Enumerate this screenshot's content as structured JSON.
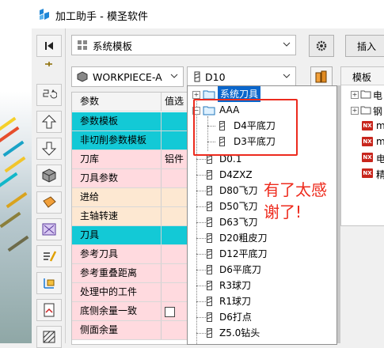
{
  "window": {
    "title": "加工助手 - 模圣软件"
  },
  "toolbar": {
    "template_combo": "系统模板",
    "workpiece_combo": "WORKPIECE-A",
    "tool_combo": "D10",
    "insert_button": "插入"
  },
  "param_table": {
    "headers": [
      "参数",
      "值选"
    ],
    "rows": [
      {
        "label": "参数模板",
        "value": "",
        "color": "cyan"
      },
      {
        "label": "非切削参数模板",
        "value": "",
        "color": "cyan"
      },
      {
        "label": "刀库",
        "value": "铝件",
        "color": "pink"
      },
      {
        "label": "刀具参数",
        "value": "",
        "color": "pink"
      },
      {
        "label": "进给",
        "value": "",
        "color": "peach"
      },
      {
        "label": "主轴转速",
        "value": "",
        "color": "peach"
      },
      {
        "label": "刀具",
        "value": "",
        "color": "cyan"
      },
      {
        "label": "参考刀具",
        "value": "",
        "color": "pink"
      },
      {
        "label": "参考重叠距离",
        "value": "",
        "color": "pink"
      },
      {
        "label": "处理中的工件",
        "value": "",
        "color": "pink"
      },
      {
        "label": "底侧余量一致",
        "value": "",
        "color": "pink",
        "checkbox": true
      },
      {
        "label": "侧面余量",
        "value": "",
        "color": "pink"
      }
    ]
  },
  "tool_dropdown": {
    "root_label": "系统刀具",
    "group_label": "AAA",
    "group_children": [
      "D4平底刀",
      "D3平底刀"
    ],
    "items": [
      "D0.1",
      "D4ZXZ",
      "D80飞刀",
      "D50飞刀",
      "D63飞刀",
      "D20粗皮刀",
      "D12平底刀",
      "D6平底刀",
      "R3球刀",
      "R1球刀",
      "D6打点",
      "Z5.0钻头"
    ]
  },
  "template_panel": {
    "header": "模板",
    "folders": [
      "电",
      "钢"
    ],
    "items": [
      "m",
      "m",
      "电",
      "精"
    ]
  },
  "annotation": {
    "text": "有了太感谢了!",
    "color": "#ee2a1c"
  },
  "colors": {
    "cyan": "#13c9d6",
    "pink": "#ffdadf",
    "peach": "#fde8d2",
    "selection": "#0a66cc",
    "highlight_box": "#ec2b1e"
  }
}
